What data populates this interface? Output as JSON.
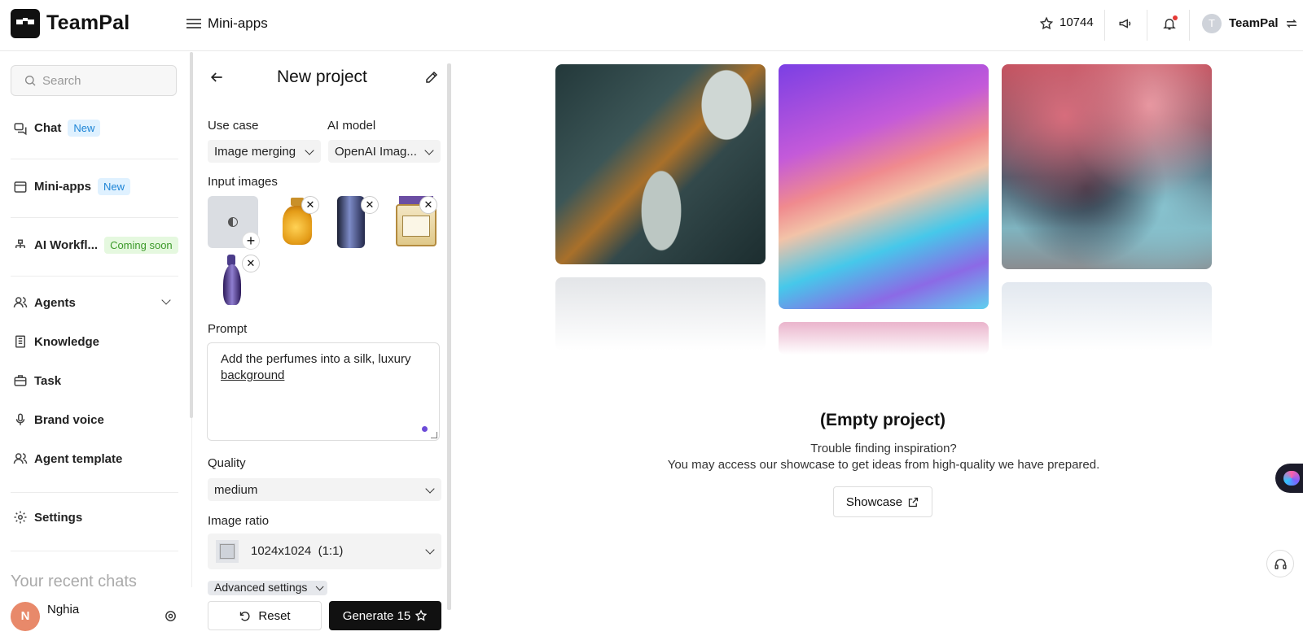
{
  "app": {
    "name": "TeamPal",
    "breadcrumb": "Mini-apps"
  },
  "topbar": {
    "star_count": "10744",
    "account_initial": "T",
    "account_name": "TeamPal"
  },
  "sidebar": {
    "search_placeholder": "Search",
    "items": [
      {
        "label": "Chat",
        "badge": "New",
        "icon": "chat-icon"
      },
      {
        "label": "Mini-apps",
        "badge": "New",
        "icon": "window-icon"
      },
      {
        "label": "AI Workfl...",
        "badge": "Coming soon",
        "icon": "workflow-icon"
      },
      {
        "label": "Agents",
        "icon": "users-icon"
      },
      {
        "label": "Knowledge",
        "icon": "book-icon"
      },
      {
        "label": "Task",
        "icon": "briefcase-icon"
      },
      {
        "label": "Brand voice",
        "icon": "microphone-icon"
      },
      {
        "label": "Agent template",
        "icon": "users-icon"
      },
      {
        "label": "Settings",
        "icon": "gear-icon"
      }
    ],
    "recent_heading": "Your recent chats",
    "user": {
      "initial": "N",
      "name": "Nghia"
    }
  },
  "panel": {
    "title": "New project",
    "use_case_label": "Use case",
    "use_case_value": "Image merging",
    "model_label": "AI model",
    "model_value": "OpenAI Imag...",
    "input_images_label": "Input images",
    "input_images_count": 4,
    "prompt_label": "Prompt",
    "prompt_value_1": "Add the perfumes into a silk, luxury",
    "prompt_value_2": "background",
    "quality_label": "Quality",
    "quality_value": "medium",
    "ratio_label": "Image ratio",
    "ratio_value": "1024x1024  (1:1)",
    "advanced_label": "Advanced settings",
    "reset_label": "Reset",
    "generate_label": "Generate 15"
  },
  "main": {
    "empty_title": "(Empty project)",
    "hint_1": "Trouble finding inspiration?",
    "hint_2": "You may access our showcase to get ideas from high-quality we have prepared.",
    "showcase_label": "Showcase"
  }
}
